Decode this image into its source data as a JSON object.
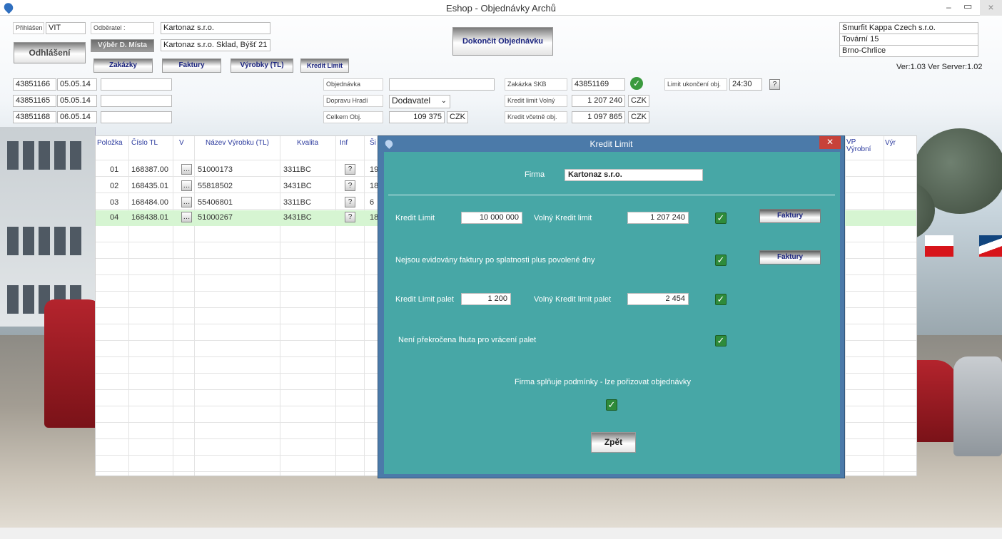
{
  "window": {
    "title": "Eshop - Objednávky Archů",
    "controls": {
      "minimize": "–",
      "restore": "▭",
      "close": "×"
    }
  },
  "login": {
    "label": "Přihlášen",
    "user": "VIT",
    "logout": "Odhlášení"
  },
  "customer": {
    "label": "Odběratel :",
    "name": "Kartonaz s.r.o.",
    "place_button": "Výběr D. Místa",
    "place": "Kartonaz s.r.o. Sklad, Býšť 21"
  },
  "finish_button": "Dokončit Objednávku",
  "nav": {
    "orders": "Zakázky",
    "invoices": "Faktury",
    "products": "Výrobky (TL)",
    "credit": "Kredit Limit"
  },
  "company": {
    "name": "Smurfit Kappa Czech s.r.o.",
    "street": "Tovární 15",
    "city": "Brno-Chrlice",
    "version": "Ver:1.03 Ver Server:1.02"
  },
  "recent_orders": [
    {
      "number": "43851166",
      "date": "05.05.14",
      "note": ""
    },
    {
      "number": "43851165",
      "date": "05.05.14",
      "note": ""
    },
    {
      "number": "43851168",
      "date": "06.05.14",
      "note": ""
    }
  ],
  "order_form": {
    "order_label": "Objednávka",
    "order_value": "",
    "transport_label": "Dopravu Hradí",
    "transport_value": "Dodavatel",
    "total_label": "Celkem Obj.",
    "total_value": "109 375",
    "total_currency": "CZK",
    "skb_label": "Zakázka SKB",
    "skb_value": "43851169",
    "free_credit_label": "Kredit limit Volný",
    "free_credit_value": "1 207 240",
    "free_credit_currency": "CZK",
    "incl_credit_label": "Kredit včetně obj.",
    "incl_credit_value": "1 097 865",
    "incl_credit_currency": "CZK",
    "deadline_label": "Limit ukončení obj.",
    "deadline_value": "24:30",
    "help": "?"
  },
  "grid": {
    "headers": [
      "Položka",
      "Číslo TL",
      "V",
      "Název Výrobku (TL)",
      "Kvalita",
      "Inf",
      "Ši"
    ],
    "right_headers": {
      "vp": "VP Výrobní",
      "vyr": "Výr"
    },
    "rows": [
      {
        "item": "01",
        "tl": "168387.00",
        "name": "51000173",
        "quality": "3311BC",
        "width": "19"
      },
      {
        "item": "02",
        "tl": "168435.01",
        "name": "55818502",
        "quality": "3431BC",
        "width": "18"
      },
      {
        "item": "03",
        "tl": "168484.00",
        "name": "55406801",
        "quality": "3311BC",
        "width": "6"
      },
      {
        "item": "04",
        "tl": "168438.01",
        "name": "51000267",
        "quality": "3431BC",
        "width": "18"
      }
    ]
  },
  "dialog": {
    "title": "Kredit Limit",
    "firm_label": "Firma",
    "firm_value": "Kartonaz s.r.o.",
    "credit_limit_label": "Kredit Limit",
    "credit_limit_value": "10 000 000",
    "free_credit_label": "Volný Kredit limit",
    "free_credit_value": "1 207 240",
    "invoices_button_1": "Faktury",
    "overdue_text": "Nejsou evidovány faktury po splatnosti plus povolené dny",
    "invoices_button_2": "Faktury",
    "pallet_limit_label": "Kredit Limit palet",
    "pallet_limit_value": "1 200",
    "free_pallet_label": "Volný Kredit limit palet",
    "free_pallet_value": "2 454",
    "pallet_return_text": "Není překročena lhuta pro vrácení palet",
    "conditions_text": "Firma splňuje podmínky - lze pořizovat objednávky",
    "back_button": "Zpět"
  }
}
